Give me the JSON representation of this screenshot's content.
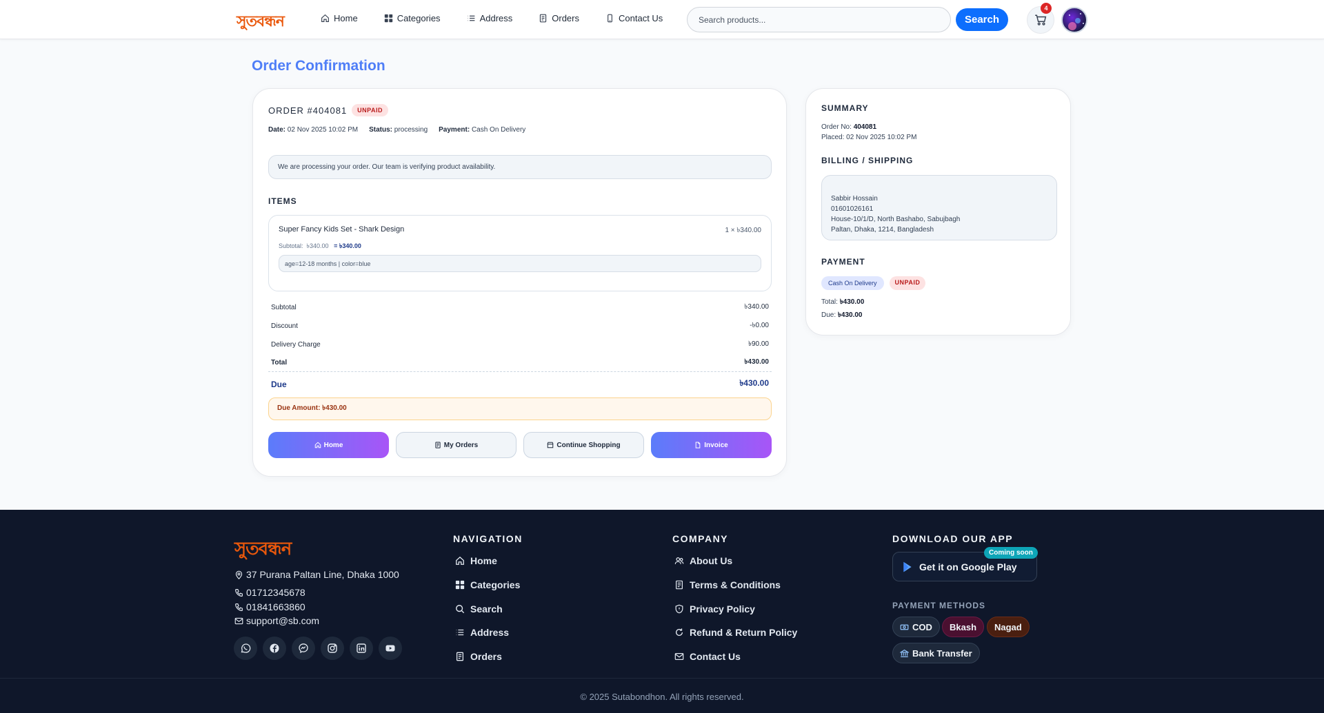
{
  "header": {
    "logo_text": "সুতবন্ধন",
    "nav": [
      {
        "label": "Home",
        "icon": "home-icon"
      },
      {
        "label": "Categories",
        "icon": "grid-icon"
      },
      {
        "label": "Address",
        "icon": "list-icon"
      },
      {
        "label": "Orders",
        "icon": "receipt-icon"
      },
      {
        "label": "Contact Us",
        "icon": "phone-icon"
      }
    ],
    "search_placeholder": "Search products...",
    "search_button": "Search",
    "cart_count": "4"
  },
  "page": {
    "title": "Order Confirmation"
  },
  "order": {
    "number_label": "ORDER #404081",
    "status_badge": "UNPAID",
    "date_label": "Date:",
    "date": "02 Nov 2025 10:02 PM",
    "status_label": "Status:",
    "status": "processing",
    "payment_label": "Payment:",
    "payment": "Cash On Delivery",
    "notice": "We are processing your order. Our team is verifying product availability.",
    "items_title": "ITEMS",
    "items": [
      {
        "name": "Super Fancy Kids Set - Shark Design",
        "qty": "1 × ৳340.00",
        "subtotal_label": "Subtotal:",
        "subtotal": "৳340.00",
        "line_total": "= ৳340.00",
        "attributes": "age=12-18 months | color=blue"
      }
    ],
    "totals": [
      {
        "label": "Subtotal",
        "value": "৳340.00"
      },
      {
        "label": "Discount",
        "value": "-৳0.00"
      },
      {
        "label": "Delivery Charge",
        "value": "৳90.00"
      },
      {
        "label": "Total",
        "value": "৳430.00"
      },
      {
        "label": "Due",
        "value": "৳430.00"
      }
    ],
    "due_amount": "Due Amount: ৳430.00",
    "actions": [
      {
        "label": "Home",
        "icon": "home-icon"
      },
      {
        "label": "My Orders",
        "icon": "receipt-icon"
      },
      {
        "label": "Continue Shopping",
        "icon": "shop-icon"
      },
      {
        "label": "Invoice",
        "icon": "file-icon"
      }
    ]
  },
  "summary": {
    "title": "SUMMARY",
    "order_no_label": "Order No:",
    "order_no": "404081",
    "placed": "Placed: 02 Nov 2025 10:02 PM",
    "billing_title": "BILLING / SHIPPING",
    "address_lines": [
      "Sabbir Hossain",
      "01601026161",
      "House-10/1/D, North Bashabo, Sabujbagh",
      "Paltan, Dhaka, 1214, Bangladesh"
    ],
    "payment_title": "PAYMENT",
    "payment_method": "Cash On Delivery",
    "payment_status": "UNPAID",
    "total_label": "Total:",
    "total": "৳430.00",
    "due_label": "Due:",
    "due": "৳430.00"
  },
  "footer": {
    "logo_text": "সুতবন্ধন",
    "address": "37 Purana Paltan Line, Dhaka 1000",
    "phones": [
      "01712345678",
      "01841663860"
    ],
    "email": "support@sb.com",
    "socials": [
      "whatsapp-icon",
      "facebook-icon",
      "messenger-icon",
      "instagram-icon",
      "linkedin-icon",
      "youtube-icon"
    ],
    "navigation_title": "NAVIGATION",
    "navigation": [
      "Home",
      "Categories",
      "Search",
      "Address",
      "Orders"
    ],
    "company_title": "COMPANY",
    "company": [
      "About Us",
      "Terms & Conditions",
      "Privacy Policy",
      "Refund & Return Policy",
      "Contact Us"
    ],
    "app_title": "DOWNLOAD OUR APP",
    "google_play": "Get it on Google Play",
    "coming_soon": "Coming soon",
    "payment_methods_title": "PAYMENT METHODS",
    "payment_methods": [
      "COD",
      "Bkash",
      "Nagad",
      "Bank Transfer"
    ],
    "copyright": "© 2025 Sutabondhon. All rights reserved."
  },
  "colors": {
    "accent": "#4f7ef7",
    "search_button": "#0d6efd",
    "brand": "#ea580c",
    "footer_bg": "#0f172a",
    "unpaid_bg": "#fde2e2",
    "unpaid_text": "#b91c1c"
  }
}
